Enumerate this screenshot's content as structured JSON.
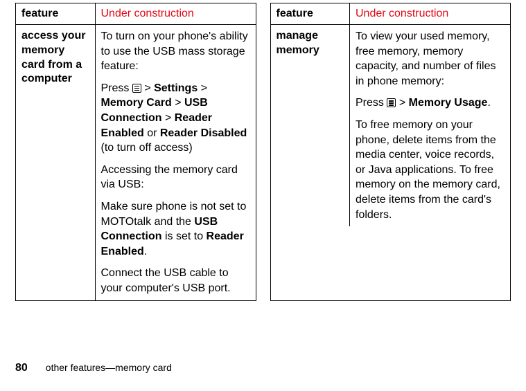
{
  "left": {
    "header": {
      "feature": "feature",
      "status": "Under construction"
    },
    "row": {
      "name": "access your memory card from a computer",
      "desc": {
        "p1_pre": "To turn on your phone's ability to use the USB mass storage feature:",
        "p2_press": "Press",
        "p2_gt1": ">",
        "p2_settings": "Settings",
        "p2_gt2": ">",
        "p2_memcard": "Memory Card",
        "p2_gt3": ">",
        "p2_usbconn": "USB Connection",
        "p2_gt4": ">",
        "p2_reader_en": "Reader Enabled",
        "p2_or": "or",
        "p2_reader_dis": "Reader Disabled",
        "p2_tail": "(to turn off access)",
        "p3": "Accessing the memory card via USB:",
        "p4_pre": "Make sure phone is not set to MOTOtalk and the",
        "p4_usbconn": "USB Connection",
        "p4_mid": "is set to",
        "p4_reader_en": "Reader Enabled",
        "p4_dot": ".",
        "p5": "Connect the USB cable to your computer's USB port."
      }
    }
  },
  "right": {
    "header": {
      "feature": "feature",
      "status": "Under construction"
    },
    "row": {
      "name": "manage memory",
      "desc": {
        "p1": "To view your used memory, free memory, memory capacity, and number of files in phone memory:",
        "p2_press": "Press",
        "p2_gt": ">",
        "p2_memusage": "Memory Usage",
        "p2_dot": ".",
        "p3": "To free memory on your phone, delete items from the media center, voice records, or Java applications. To free memory on the memory card, delete items from the card's folders."
      }
    }
  },
  "footer": {
    "page": "80",
    "text": "other features—memory card"
  }
}
